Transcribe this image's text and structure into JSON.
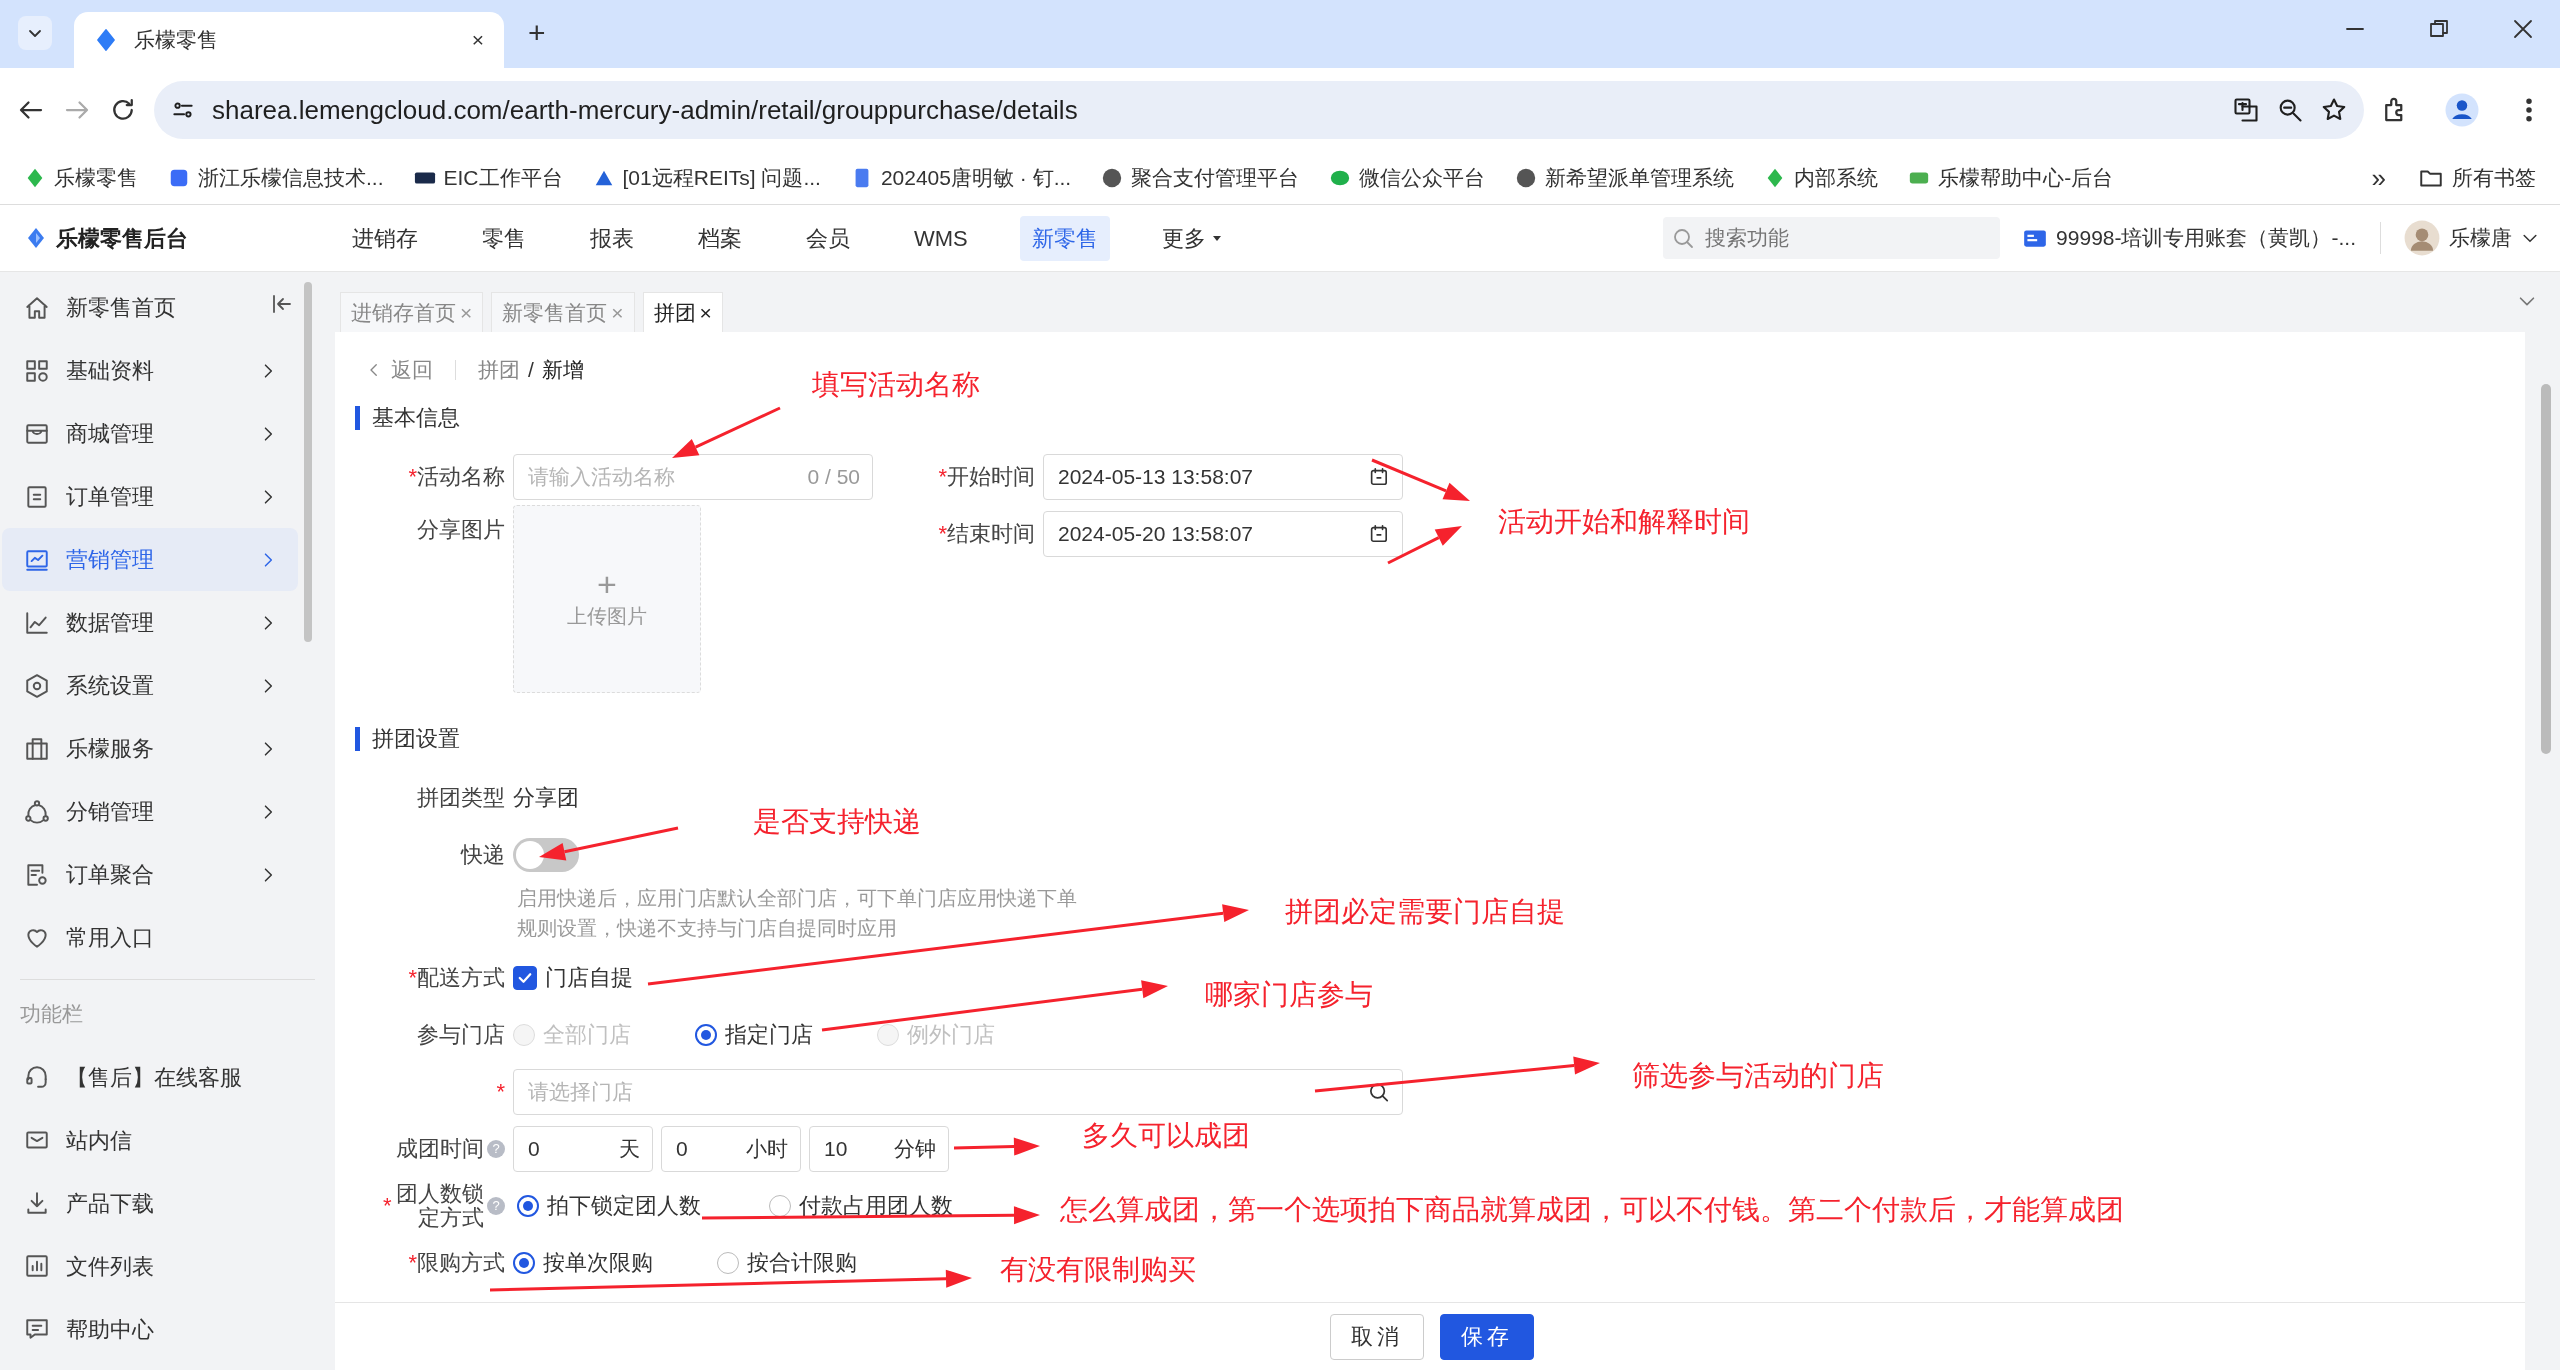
{
  "browser": {
    "tabs": [
      {
        "title": "乐檬零售",
        "selected": true,
        "close": "×"
      }
    ],
    "new_tab": "+",
    "url": "sharea.lemengcloud.com/earth-mercury-admin/retail/grouppurchase/details",
    "bookmarks": [
      {
        "title": "乐檬零售",
        "color": "#2db84d"
      },
      {
        "title": "浙江乐檬信息技术...",
        "color": "#3b6cf6"
      },
      {
        "title": "EIC工作平台",
        "color": "#1a2a4a"
      },
      {
        "title": "[01远程REITs] 问题...",
        "color": "#2462d8"
      },
      {
        "title": "202405唐明敏 · 钉...",
        "color": "#4a7bf0"
      },
      {
        "title": "聚合支付管理平台",
        "color": "#555555"
      },
      {
        "title": "微信公众平台",
        "color": "#20b04b"
      },
      {
        "title": "新希望派单管理系统",
        "color": "#555555"
      },
      {
        "title": "内部系统",
        "color": "#2db84d"
      },
      {
        "title": "乐檬帮助中心-后台",
        "color": "#4caf50"
      }
    ],
    "more": "»",
    "all_bookmarks": "所有书签"
  },
  "header": {
    "logo": "乐檬零售后台",
    "nav": [
      {
        "label": "进销存",
        "selected": false,
        "dropdown": false
      },
      {
        "label": "零售",
        "selected": false,
        "dropdown": false
      },
      {
        "label": "报表",
        "selected": false,
        "dropdown": false
      },
      {
        "label": "档案",
        "selected": false,
        "dropdown": false
      },
      {
        "label": "会员",
        "selected": false,
        "dropdown": false
      },
      {
        "label": "WMS",
        "selected": false,
        "dropdown": false
      },
      {
        "label": "新零售",
        "selected": true,
        "dropdown": false
      },
      {
        "label": "更多",
        "selected": false,
        "dropdown": true
      }
    ],
    "search": {
      "placeholder": "搜索功能"
    },
    "account": "99998-培训专用账套（黄凯）-...",
    "user": "乐檬唐"
  },
  "sidebar": {
    "items": [
      {
        "label": "新零售首页",
        "selected": false,
        "arrow": false
      },
      {
        "label": "基础资料",
        "selected": false,
        "arrow": true
      },
      {
        "label": "商城管理",
        "selected": false,
        "arrow": true
      },
      {
        "label": "订单管理",
        "selected": false,
        "arrow": true
      },
      {
        "label": "营销管理",
        "selected": true,
        "arrow": true
      },
      {
        "label": "数据管理",
        "selected": false,
        "arrow": true
      },
      {
        "label": "系统设置",
        "selected": false,
        "arrow": true
      },
      {
        "label": "乐檬服务",
        "selected": false,
        "arrow": true
      },
      {
        "label": "分销管理",
        "selected": false,
        "arrow": true
      },
      {
        "label": "订单聚合",
        "selected": false,
        "arrow": true
      },
      {
        "label": "常用入口",
        "selected": false,
        "arrow": false
      }
    ],
    "section": "功能栏",
    "tools": [
      {
        "label": "【售后】在线客服"
      },
      {
        "label": "站内信"
      },
      {
        "label": "产品下载"
      },
      {
        "label": "文件列表"
      },
      {
        "label": "帮助中心"
      }
    ]
  },
  "page_tabs": [
    {
      "label": "进销存首页",
      "selected": false,
      "close": "×"
    },
    {
      "label": "新零售首页",
      "selected": false,
      "close": "×"
    },
    {
      "label": "拼团",
      "selected": true,
      "close": "×"
    }
  ],
  "breadcrumb": {
    "back": "返回",
    "separator": "/",
    "path": [
      {
        "label": "拼团",
        "current": false
      },
      {
        "label": "新增",
        "current": true
      }
    ]
  },
  "basic": {
    "title": "基本信息",
    "name": {
      "mark": "*",
      "label": "活动名称",
      "placeholder": "请输入活动名称",
      "counter": "0 / 50"
    },
    "image": {
      "label": "分享图片",
      "plus": "+",
      "text": "上传图片"
    },
    "start": {
      "mark": "*",
      "label": "开始时间",
      "value": "2024-05-13 13:58:07"
    },
    "end": {
      "mark": "*",
      "label": "结束时间",
      "value": "2024-05-20 13:58:07"
    }
  },
  "group": {
    "title": "拼团设置",
    "type": {
      "label": "拼团类型",
      "value": "分享团"
    },
    "express": {
      "label": "快递",
      "on": false,
      "note": "启用快递后，应用门店默认全部门店，可下单门店应用快递下单规则设置，快递不支持与门店自提同时应用"
    },
    "delivery": {
      "mark": "*",
      "label": "配送方式",
      "option": "门店自提",
      "checked": true
    },
    "stores": {
      "label": "参与门店",
      "options": [
        {
          "label": "全部门店",
          "selected": false,
          "disabled": true
        },
        {
          "label": "指定门店",
          "selected": true,
          "disabled": false
        },
        {
          "label": "例外门店",
          "selected": false,
          "disabled": true
        }
      ]
    },
    "store_select": {
      "mark": "*",
      "placeholder": "请选择门店"
    },
    "duration": {
      "label": "成团时间",
      "help": "?",
      "fields": [
        {
          "value": "0",
          "unit": "天"
        },
        {
          "value": "0",
          "unit": "小时"
        },
        {
          "value": "10",
          "unit": "分钟"
        }
      ]
    },
    "lock": {
      "mark": "*",
      "label": "团人数锁定方式",
      "help": "?",
      "options": [
        {
          "label": "拍下锁定团人数",
          "selected": true,
          "disabled": false
        },
        {
          "label": "付款占用团人数",
          "selected": false,
          "disabled": false
        }
      ]
    },
    "limit": {
      "mark": "*",
      "label": "限购方式",
      "options": [
        {
          "label": "按单次限购",
          "selected": true,
          "disabled": false
        },
        {
          "label": "按合计限购",
          "selected": false,
          "disabled": false
        }
      ]
    }
  },
  "footer": {
    "buttons": [
      {
        "label": "取消",
        "kind": "secondary"
      },
      {
        "label": "保存",
        "kind": "primary"
      }
    ]
  },
  "annotations": [
    {
      "text": "填写活动名称"
    },
    {
      "text": "活动开始和解释时间"
    },
    {
      "text": "是否支持快递"
    },
    {
      "text": "拼团必定需要门店自提"
    },
    {
      "text": "哪家门店参与"
    },
    {
      "text": "筛选参与活动的门店"
    },
    {
      "text": "多久可以成团"
    },
    {
      "text": "怎么算成团，第一个选项拍下商品就算成团，可以不付钱。第二个付款后，才能算成团"
    },
    {
      "text": "有没有限制购买"
    }
  ]
}
